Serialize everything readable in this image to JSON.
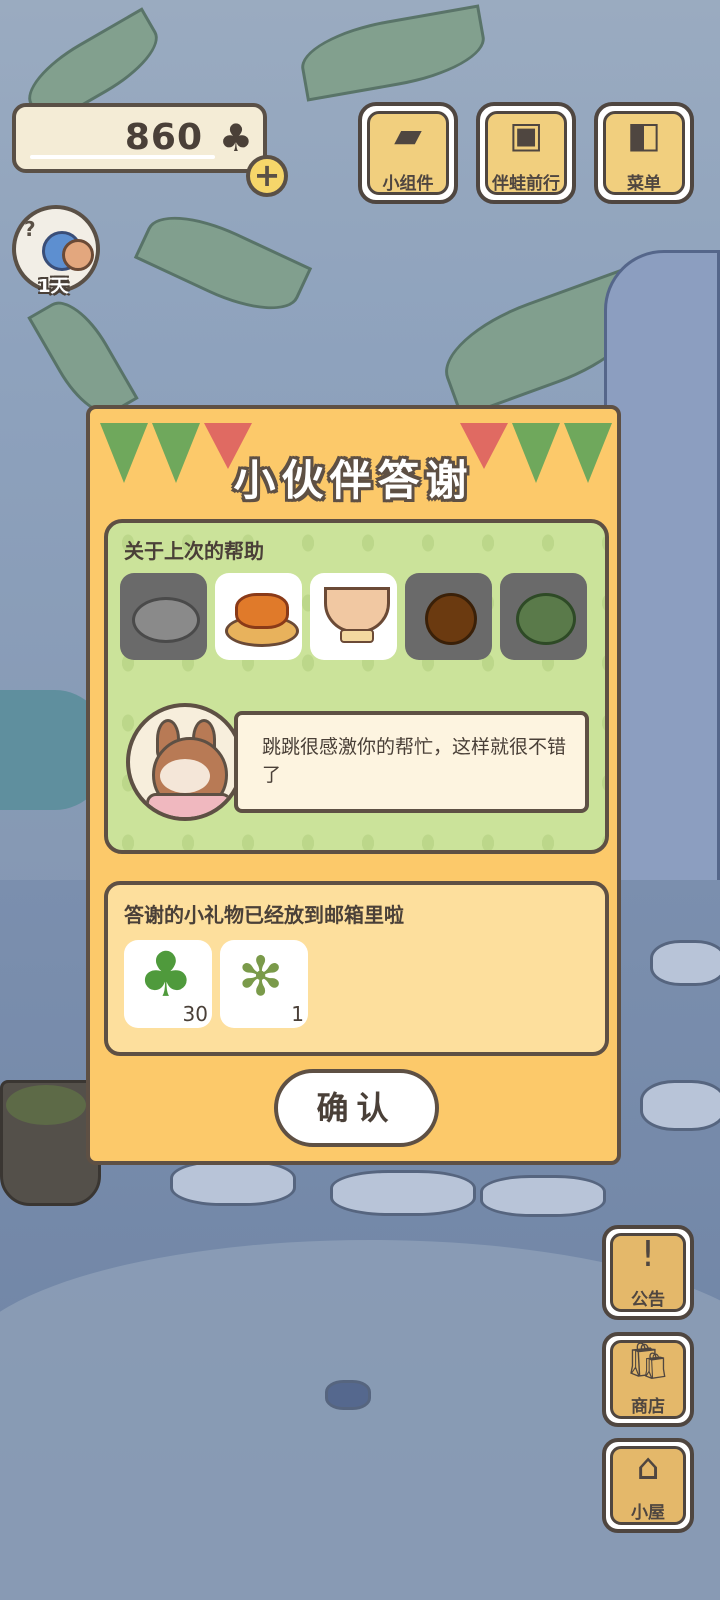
{
  "hud": {
    "clover_count": "860",
    "clover_icon": "♣",
    "add_symbol": "+",
    "days_label": "1天"
  },
  "top_buttons": [
    {
      "label": "小组件",
      "icon": "widget-icon"
    },
    {
      "label": "伴蛙前行",
      "icon": "frog-journey-icon"
    },
    {
      "label": "菜单",
      "icon": "menu-icon"
    }
  ],
  "side_buttons": [
    {
      "label": "公告",
      "icon": "notice-icon",
      "glyph": "!"
    },
    {
      "label": "商店",
      "icon": "shop-icon",
      "glyph": "🛍"
    },
    {
      "label": "小屋",
      "icon": "house-icon",
      "glyph": "⌂"
    }
  ],
  "dialog": {
    "title": "小伙伴答谢",
    "help_section_title": "关于上次的帮助",
    "food_items": [
      {
        "name": "stir-fry-dish",
        "unlocked": false
      },
      {
        "name": "fried-snack-platter",
        "unlocked": true
      },
      {
        "name": "bowl-of-soup",
        "unlocked": true
      },
      {
        "name": "orange-fruit",
        "unlocked": false
      },
      {
        "name": "cabbage",
        "unlocked": false
      }
    ],
    "message": "跳跳很感激你的帮忙，这样就很不错了",
    "gift_section_title": "答谢的小礼物已经放到邮箱里啦",
    "gifts": [
      {
        "name": "clover",
        "qty": "30"
      },
      {
        "name": "herb-sprig",
        "qty": "1"
      }
    ],
    "confirm_label": "确认"
  },
  "colors": {
    "dialog_bg": "#fcc96a",
    "help_panel_bg": "#cbe39a",
    "gift_panel_bg": "#fddf9d",
    "outline": "#5e5044",
    "flag_green": "#6fa85c",
    "flag_red": "#e06a62"
  }
}
